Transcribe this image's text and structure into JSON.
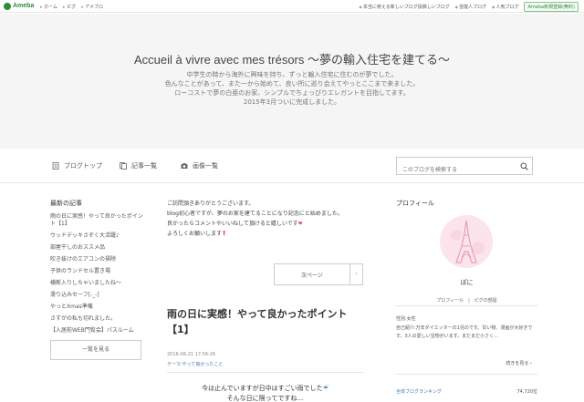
{
  "topbar": {
    "logo": "Ameba",
    "nav": [
      "ホーム",
      "ピグ",
      "アメブロ"
    ],
    "right": [
      "芸能人ブログ",
      "人気ブログ"
    ],
    "right_first": "本当に使える新しいブログ投稿しいブログ",
    "register": "Ameba新規登録(無料)"
  },
  "header": {
    "title": "Accueil à vivre avec mes trésors ～夢の輸入住宅を建てる～",
    "desc": [
      "中学生の時から海外に興味を持ち、ずっと輸入住宅に住むのが夢でした。",
      "色んなことがあって、また一から始めて、良い所に巡り会えてやっとここまで来ました。",
      "ローコストで夢の白亜のお家、シンプルでちょっぴりエレガントを目指してます。",
      "2015年3月ついに完成しました。"
    ]
  },
  "navbar": {
    "items": [
      "ブログトップ",
      "記事一覧",
      "画像一覧"
    ],
    "search_placeholder": "このブログを検索する"
  },
  "left": {
    "heading": "最新の記事",
    "articles": [
      "雨の日に実感！やって良かったポイント【1】",
      "ウッドデッキさぞく大活躍♪",
      "部屋干しのおススメ品",
      "吹き抜けのエアコンの掃除",
      "子供のランドセル置き場",
      "横断入りしちゃいましたね〜",
      "滑り込みセーフ[-_-]",
      "やっとXmas準備",
      "さすがの私も切れました。",
      "【入居前WEB門覧会】パスルーム"
    ],
    "more": "一覧を見る"
  },
  "center": {
    "intro": [
      "ご訪問頂きありがとうございます。",
      "blog初心者ですが、夢のお家を建てることになり記念にと始めました。",
      "良かったらコメントやいいねして頂けると嬉しいです",
      "よろしくお願いします"
    ],
    "next_label": "次ページ",
    "entry_title": "雨の日に実感！やって良かったポイント【1】",
    "entry_date": "2016-06-21 17:56:26",
    "entry_theme": "テーマ:やって良かったこと",
    "entry_body": [
      "今は止んでいますが日中はすごい雨でした",
      "そんな日に限ってですね…"
    ]
  },
  "right": {
    "heading": "プロフィール",
    "name": "ぽに",
    "links": "プロフィール　|　ピグの部屋",
    "gender": "性別:女性",
    "bio": "自己紹介:万年ダイエッターの1児のです。甘い物、漫画が大好きです。3人の愛しい宝物がいます。まだまだ小さく…",
    "more": "続きを見る",
    "rank_label": "全体ブログランキング",
    "rank_value": "74,720位"
  },
  "colors": {
    "accent_green": "#2d8c3c",
    "link_blue": "#3a78b5",
    "header_bg": "#f5f5f5"
  }
}
